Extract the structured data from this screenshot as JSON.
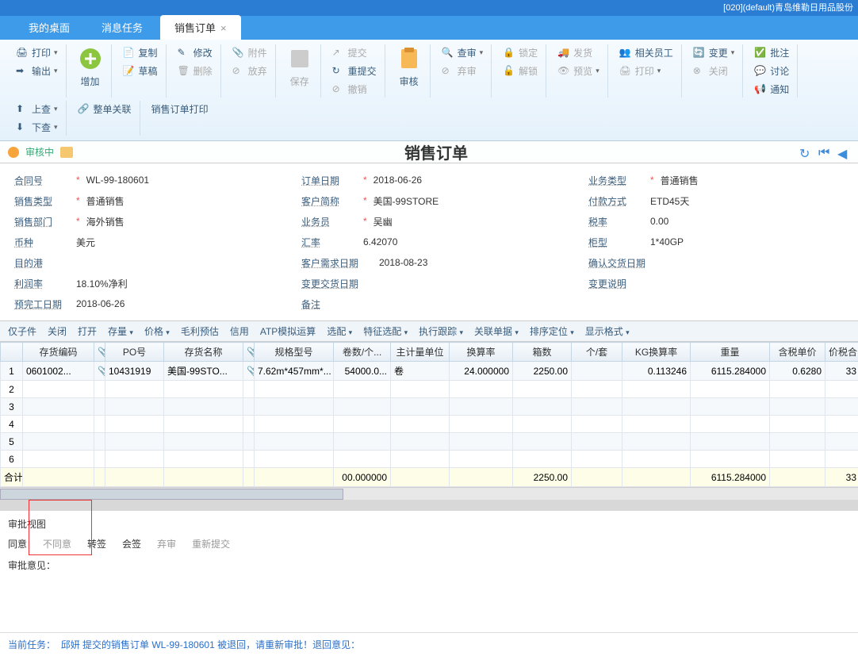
{
  "titlebar": "[020](default)青岛维勒日用品股份",
  "tabs": {
    "desktop": "我的桌面",
    "msgtask": "消息任务",
    "salesorder": "销售订单"
  },
  "tb": {
    "print": "打印",
    "export": "输出",
    "add": "增加",
    "copy": "复制",
    "modify": "修改",
    "attachment": "附件",
    "draft": "草稿",
    "delete": "删除",
    "abandon": "放弃",
    "save": "保存",
    "submit": "提交",
    "resubmit": "重提交",
    "revoke": "撤销",
    "audit": "审核",
    "review": "查审",
    "discard": "弃审",
    "lock": "锁定",
    "unlock": "解锁",
    "ship": "发货",
    "preview": "预览",
    "related_staff": "相关员工",
    "printlist": "打印",
    "change": "变更",
    "close": "关闭",
    "approve": "批注",
    "discuss": "讨论",
    "notify": "通知",
    "up": "上查",
    "down": "下查",
    "whole_assoc": "整单关联",
    "sales_print": "销售订单打印"
  },
  "status": {
    "text": "审核中",
    "title": "销售订单"
  },
  "form": {
    "contract_no_lbl": "合同号",
    "contract_no": "WL-99-180601",
    "sales_type_lbl": "销售类型",
    "sales_type": "普通销售",
    "sales_dept_lbl": "销售部门",
    "sales_dept": "海外销售",
    "currency_lbl": "币种",
    "currency": "美元",
    "dest_port_lbl": "目的港",
    "profit_lbl": "利润率",
    "profit": "18.10%净利",
    "pre_date_lbl": "预完工日期",
    "pre_date": "2018-06-26",
    "order_date_lbl": "订单日期",
    "order_date": "2018-06-26",
    "customer_lbl": "客户简称",
    "customer": "美国-99STORE",
    "salesman_lbl": "业务员",
    "salesman": "吴幽",
    "rate_lbl": "汇率",
    "rate": "6.42070",
    "req_date_lbl": "客户需求日期",
    "req_date": "2018-08-23",
    "change_date_lbl": "变更交货日期",
    "remark_lbl": "备注",
    "biz_type_lbl": "业务类型",
    "biz_type": "普通销售",
    "pay_lbl": "付款方式",
    "pay": "ETD45天",
    "tax_lbl": "税率",
    "tax": "0.00",
    "container_lbl": "柜型",
    "container": "1*40GP",
    "confirm_date_lbl": "确认交货日期",
    "change_desc_lbl": "变更说明"
  },
  "gridtb": {
    "only_sub": "仅子件",
    "close": "关闭",
    "open": "打开",
    "stock": "存量",
    "price": "价格",
    "gross": "毛利预估",
    "credit": "信用",
    "atp": "ATP模拟运算",
    "match": "选配",
    "feature": "特征选配",
    "track": "执行跟踪",
    "assoc": "关联单据",
    "sort": "排序定位",
    "display": "显示格式"
  },
  "cols": {
    "code": "存货编码",
    "po": "PO号",
    "name": "存货名称",
    "spec": "规格型号",
    "rolls": "卷数/个...",
    "unit": "主计量单位",
    "convrate": "换算率",
    "boxes": "箱数",
    "perset": "个/套",
    "kgrate": "KG换算率",
    "weight": "重量",
    "taxprice": "含税单价",
    "taxamt": "价税合"
  },
  "rows": [
    {
      "n": "1",
      "code": "0601002...",
      "po": "10431919",
      "name": "美国-99STO...",
      "spec": "7.62m*457mm*...",
      "rolls": "54000.0...",
      "unit": "卷",
      "convrate": "24.000000",
      "boxes": "2250.00",
      "perset": "",
      "kgrate": "0.113246",
      "weight": "6115.284000",
      "taxprice": "0.6280",
      "taxamt": "33"
    }
  ],
  "total": {
    "lbl": "合计",
    "rolls": "00.000000",
    "boxes": "2250.00",
    "weight": "6115.284000",
    "taxamt": "33"
  },
  "approval": {
    "hdr": "审批视图",
    "agree": "同意",
    "disagree": "不同意",
    "transfer": "转签",
    "cosign": "会签",
    "discard": "弃审",
    "resubmit": "重新提交",
    "opinion_lbl": "审批意见："
  },
  "task": {
    "lbl": "当前任务：",
    "msg": "邱妍 提交的销售订单 WL-99-180601 被退回，请重新审批！退回意见："
  }
}
